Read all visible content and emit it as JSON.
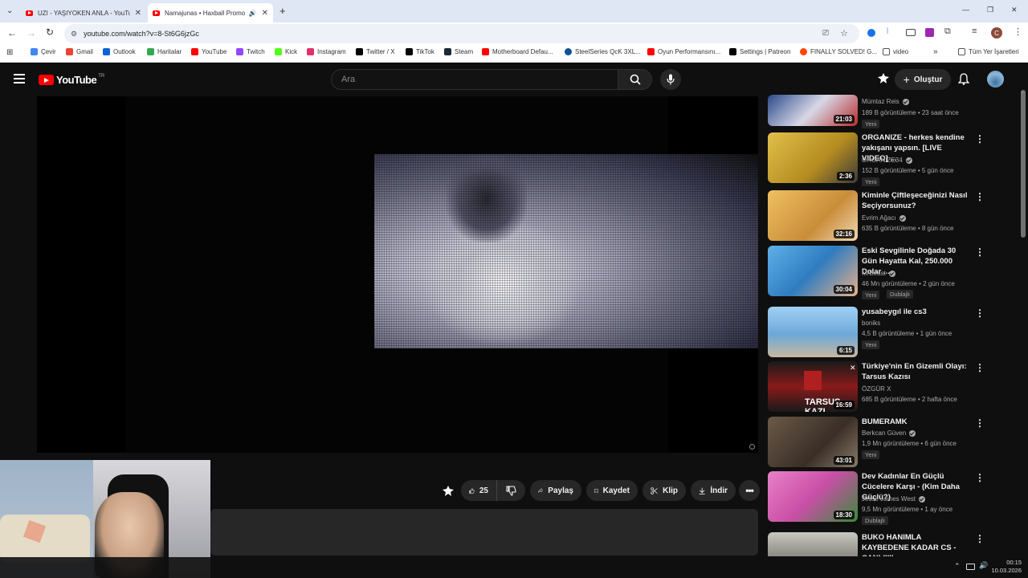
{
  "browser": {
    "tabs": [
      {
        "title": "UZI - YAŞIYOKEN ANLA - YouTube",
        "active": false
      },
      {
        "title": "Namajunas • Haxball Promo",
        "active": true
      }
    ],
    "new_tab": "+",
    "url": "youtube.com/watch?v=8-St6G6jzGc",
    "window_controls": {
      "minimize": "—",
      "maximize": "❐",
      "close": "✕"
    }
  },
  "bookmarks": [
    {
      "label": "Çevir",
      "icon": "translate-icon",
      "color": "#4285f4"
    },
    {
      "label": "Gmail",
      "icon": "gmail-icon",
      "color": "#ea4335"
    },
    {
      "label": "Outlook",
      "icon": "outlook-icon",
      "color": "#0a64d6"
    },
    {
      "label": "Haritalar",
      "icon": "maps-icon",
      "color": "#34a853"
    },
    {
      "label": "YouTube",
      "icon": "youtube-icon",
      "color": "#ff0000"
    },
    {
      "label": "Twitch",
      "icon": "twitch-icon",
      "color": "#9146ff"
    },
    {
      "label": "Kick",
      "icon": "kick-icon",
      "color": "#53fc18"
    },
    {
      "label": "Instagram",
      "icon": "instagram-icon",
      "color": "#e1306c"
    },
    {
      "label": "Twitter / X",
      "icon": "x-icon",
      "color": "#000000"
    },
    {
      "label": "TikTok",
      "icon": "tiktok-icon",
      "color": "#000000"
    },
    {
      "label": "Steam",
      "icon": "steam-icon",
      "color": "#1b2838"
    },
    {
      "label": "Motherboard Defau...",
      "icon": "youtube-icon",
      "color": "#ff0000"
    },
    {
      "label": "SteelSeries QcK 3XL...",
      "icon": "steelseries-icon",
      "color": "#0b5394"
    },
    {
      "label": "Oyun Performansını...",
      "icon": "youtube-icon",
      "color": "#ff0000"
    },
    {
      "label": "Settings | Patreon",
      "icon": "patreon-icon",
      "color": "#000000"
    },
    {
      "label": "FINALLY SOLVED! G...",
      "icon": "reddit-icon",
      "color": "#ff4500"
    },
    {
      "label": "video",
      "icon": "folder-icon",
      "color": "#555555"
    }
  ],
  "bookmarks_more": "»",
  "bookmarks_all": "Tüm Yer İşaretleri",
  "youtube": {
    "logo_text": "YouTube",
    "logo_region": "TR",
    "search_placeholder": "Ara",
    "create_label": "Oluştur"
  },
  "actions": {
    "likes": "25",
    "share": "Paylaş",
    "save": "Kaydet",
    "clip": "Klip",
    "download": "İndir"
  },
  "recommendations": [
    {
      "title": "",
      "channel": "Mümtaz Reis",
      "verified": true,
      "meta": "189 B görüntüleme • 23 saat önce",
      "badge": "Yeni",
      "duration": "21:03",
      "thumb": "#2b4a8a"
    },
    {
      "title": "ORGANIZE - herkes kendine yakışanı yapsın. [LIVE VIDEO] ...",
      "channel": "ORGANIZE34",
      "verified": true,
      "meta": "152 B görüntüleme • 5 gün önce",
      "badge": "Yeni",
      "duration": "2:36",
      "thumb": "#c9a227"
    },
    {
      "title": "Kiminle Çiftleşeceğinizi Nasıl Seçiyorsunuz?",
      "channel": "Evrim Ağacı",
      "verified": true,
      "meta": "635 B görüntüleme • 8 gün önce",
      "badge": "",
      "duration": "32:16",
      "thumb": "#d4a03a"
    },
    {
      "title": "Eski Sevgilinle Doğada 30 Gün Hayatta Kal, 250.000 Dolar ...",
      "channel": "MrBeast",
      "verified": true,
      "meta": "46 Mn görüntüleme • 2 gün önce",
      "badge": "Yeni",
      "badge2": "Dublajlı",
      "duration": "30:04",
      "thumb": "#3f8fd1"
    },
    {
      "title": "yusabeygıl ile cs3",
      "channel": "boniks",
      "verified": false,
      "meta": "4,5 B görüntüleme • 1 gün önce",
      "badge": "Yeni",
      "duration": "6:15",
      "thumb": "#6ea8d8"
    },
    {
      "title": "Türkiye'nin En Gizemli Olayı: Tarsus Kazısı",
      "channel": "ÖZGÜR X",
      "verified": false,
      "meta": "685 B görüntüleme • 2 hafta önce",
      "badge": "",
      "duration": "16:59",
      "thumb": "#8a1a1a",
      "thumb_text": "TARSUS KAZI"
    },
    {
      "title": "BUMERAMK",
      "channel": "Berkcan Güven",
      "verified": true,
      "meta": "1,9 Mn görüntüleme • 6 gün önce",
      "badge": "Yeni",
      "duration": "43:01",
      "thumb": "#5a4a3a"
    },
    {
      "title": "Dev Kadınlar En Güçlü Cücelere Karşı - (Kim Daha Güçlü?)",
      "channel": "Jesse James West",
      "verified": true,
      "meta": "9,5 Mn görüntüleme • 1 ay önce",
      "badge": "",
      "badge2": "Dublajlı",
      "duration": "18:30",
      "thumb": "#c94fa6"
    },
    {
      "title": "BUKO HANIMLA KAYBEDENE KADAR CS - CANLIIIII",
      "channel": "",
      "verified": false,
      "meta": "",
      "badge": "",
      "duration": "",
      "thumb": "#a8a8a0"
    }
  ],
  "taskbar": {
    "time": "00:15",
    "date": "10.03.2026"
  }
}
